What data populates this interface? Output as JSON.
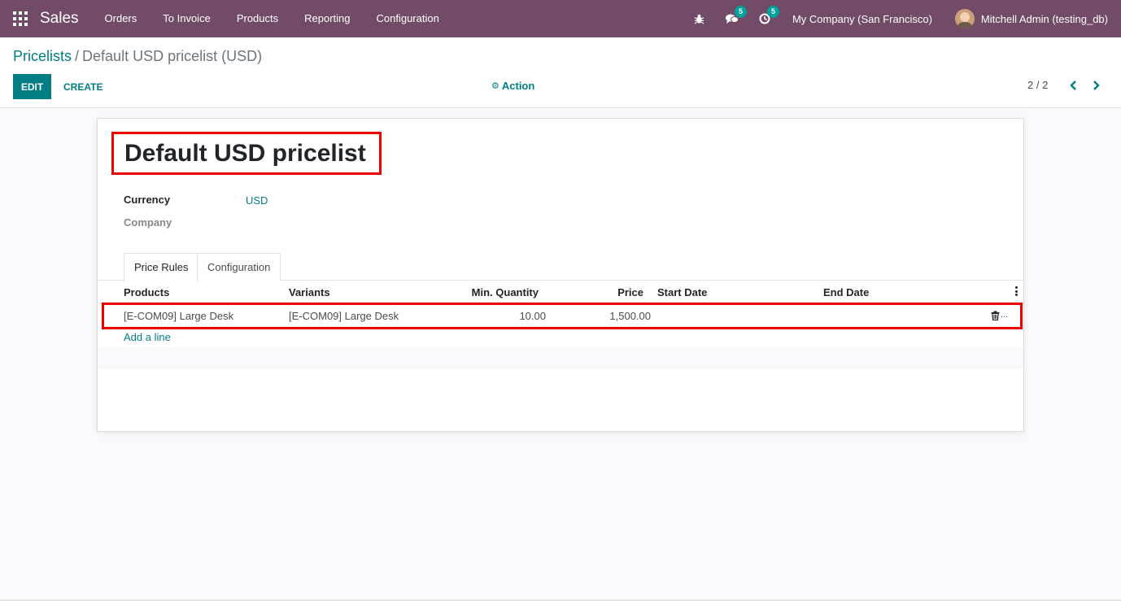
{
  "navbar": {
    "app_name": "Sales",
    "menu": [
      "Orders",
      "To Invoice",
      "Products",
      "Reporting",
      "Configuration"
    ],
    "messages_badge": "5",
    "activities_badge": "5",
    "company": "My Company (San Francisco)",
    "user": "Mitchell Admin (testing_db)",
    "color": "#714b67"
  },
  "control_panel": {
    "breadcrumb_parent": "Pricelists",
    "breadcrumb_separator": "/",
    "breadcrumb_current": "Default USD pricelist (USD)",
    "edit_label": "EDIT",
    "create_label": "CREATE",
    "action_label": "Action",
    "pager": "2 / 2"
  },
  "form": {
    "title": "Default USD pricelist",
    "currency_label": "Currency",
    "currency_value": "USD",
    "company_label": "Company",
    "company_value": "",
    "tabs": [
      "Price Rules",
      "Configuration"
    ],
    "table": {
      "columns": [
        "Products",
        "Variants",
        "Min. Quantity",
        "Price",
        "Start Date",
        "End Date"
      ],
      "rows": [
        {
          "product": "[E-COM09] Large Desk",
          "variant": "[E-COM09] Large Desk",
          "min_qty": "10.00",
          "price": "1,500.00",
          "start_date": "",
          "end_date": ""
        }
      ],
      "add_line": "Add a line",
      "row_ellipsis": "..."
    }
  },
  "colors": {
    "accent": "#017e84",
    "highlight": "#ee0000"
  }
}
